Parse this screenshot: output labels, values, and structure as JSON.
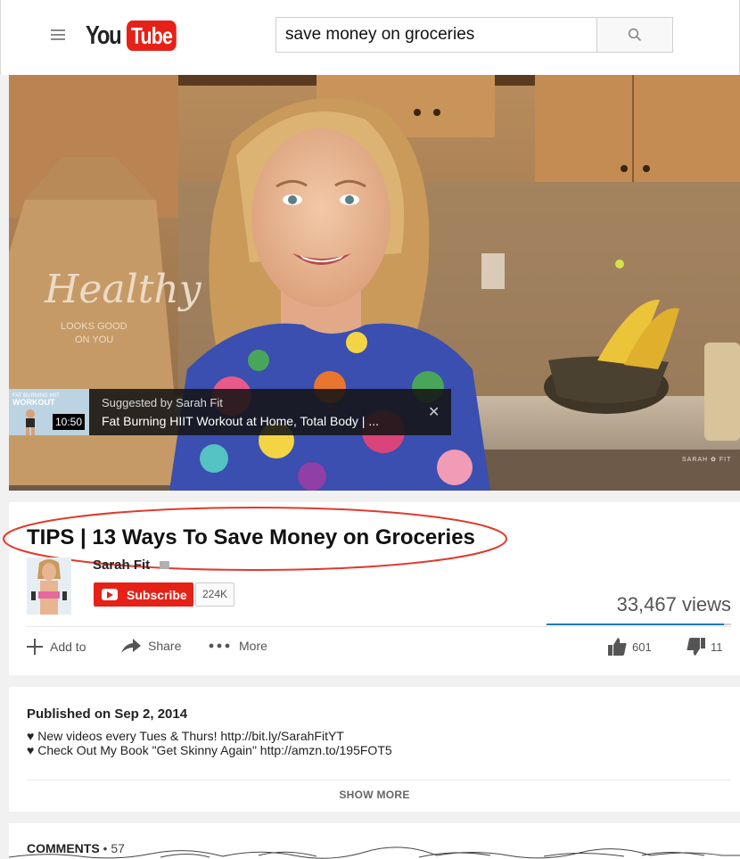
{
  "header": {
    "logo_you": "You",
    "logo_tube": "Tube",
    "search_value": "save money on groceries"
  },
  "player": {
    "bag_text_1": "Healthy",
    "bag_text_2": "LOOKS GOOD",
    "bag_text_3": "ON YOU",
    "suggestion": {
      "thumb_text_1": "FAT BURNING HIIT",
      "thumb_text_2": "WORKOUT",
      "duration": "10:50",
      "suggested_by": "Suggested by Sarah Fit",
      "title": "Fat Burning HIIT Workout at Home, Total Body | ...",
      "close": "✕"
    },
    "watermark": "SARAH ✿ FIT"
  },
  "video": {
    "title": "TIPS | 13 Ways To Save Money on Groceries",
    "channel": "Sarah Fit",
    "subscribe_label": "Subscribe",
    "subscriber_count": "224K",
    "views": "33,467 views",
    "view_bar_fraction": 0.96,
    "actions": {
      "add_to": "Add to",
      "share": "Share",
      "more": "More"
    },
    "likes": "601",
    "dislikes": "11"
  },
  "description": {
    "published": "Published on Sep 2, 2014",
    "lines": [
      "♥ New videos every Tues & Thurs! http://bit.ly/SarahFitYT",
      "♥ Check Out My Book \"Get Skinny Again\" http://amzn.to/195FOT5"
    ],
    "show_more": "SHOW MORE"
  },
  "comments": {
    "label": "COMMENTS",
    "separator": " • ",
    "count": "57"
  },
  "colors": {
    "brand_red": "#e62117",
    "link_blue": "#167ac6",
    "annotation_red": "#e03a2e"
  }
}
